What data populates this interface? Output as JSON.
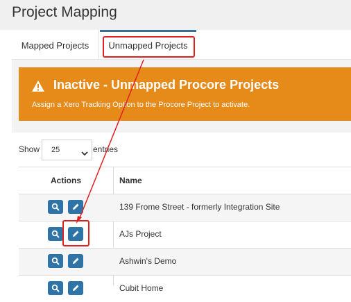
{
  "page": {
    "title": "Project Mapping"
  },
  "tabs": [
    {
      "label": "Mapped Projects",
      "active": false
    },
    {
      "label": "Unmapped Projects",
      "active": true
    }
  ],
  "alert": {
    "icon": "warning-triangle-icon",
    "title": "Inactive - Unmapped Procore Projects",
    "message": "Assign a Xero Tracking Option to the Procore Project to activate.",
    "color": "#e68a1a"
  },
  "length_menu": {
    "show_label": "Show",
    "value": "25",
    "entries_label": "entries"
  },
  "table": {
    "columns": [
      "Actions",
      "Name"
    ],
    "rows": [
      {
        "name": "139 Frome Street - formerly Integration Site"
      },
      {
        "name": "AJs Project"
      },
      {
        "name": "Ashwin's Demo"
      },
      {
        "name": "Cubit Home"
      }
    ]
  },
  "colors": {
    "accent": "#2f74a6",
    "annotation": "#e02020"
  }
}
